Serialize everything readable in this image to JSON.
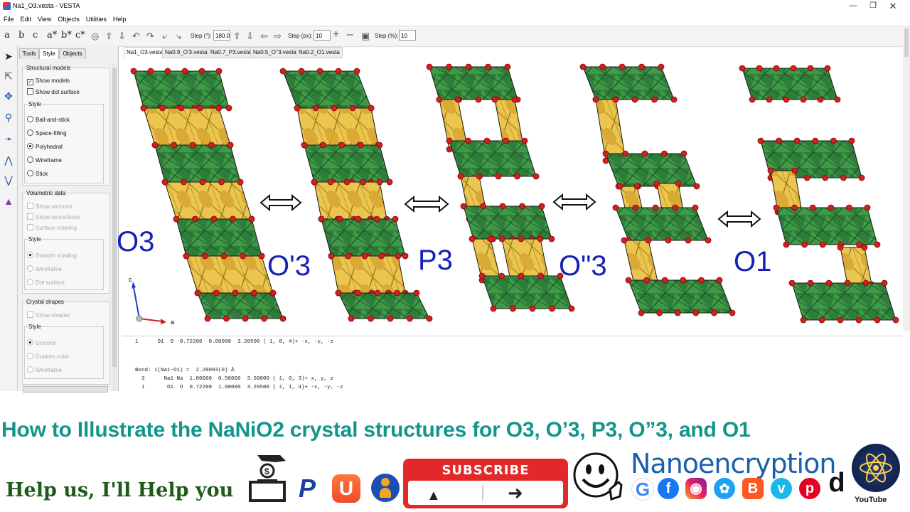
{
  "window": {
    "title": "Na1_O3.vesta - VESTA"
  },
  "menu": [
    "File",
    "Edit",
    "View",
    "Objects",
    "Utilities",
    "Help"
  ],
  "toolbar": {
    "axis_buttons": [
      "a",
      "b",
      "c",
      "a*",
      "b*",
      "c*"
    ],
    "step_deg_label": "Step (°):",
    "step_deg_value": "180.0",
    "step_px_label": "Step (px):",
    "step_px_value": "10",
    "step_pct_label": "Step (%):",
    "step_pct_value": "10"
  },
  "panel": {
    "tabs": [
      "Tools",
      "Style",
      "Objects"
    ],
    "structural": {
      "title": "Structural models",
      "show_models": "Show models",
      "show_dot_surface": "Show dot surface",
      "style_title": "Style",
      "styles": [
        "Ball-and-stick",
        "Space-filling",
        "Polyhedral",
        "Wireframe",
        "Stick"
      ],
      "selected_style": "Polyhedral"
    },
    "volumetric": {
      "title": "Volumetric data",
      "options": [
        "Show sections",
        "Show isosurfaces",
        "Surface coloring"
      ],
      "style_title": "Style",
      "styles": [
        "Smooth shading",
        "Wireframe",
        "Dot surface"
      ]
    },
    "crystal": {
      "title": "Crystal shapes",
      "show_shapes": "Show shapes",
      "style_title": "Style",
      "styles": [
        "Unicolor",
        "Custom color",
        "Wireframe"
      ]
    }
  },
  "doc_tabs": [
    "Na1_O3.vesta",
    "Na0.9_O'3.vesta",
    "Na0.7_P3.vesta",
    "Na0.5_O''3.vesta",
    "Na0.2_O1.vesta"
  ],
  "structures": {
    "labels": [
      "O3",
      "O'3",
      "P3",
      "O\"3",
      "O1"
    ],
    "axis_c": "c",
    "axis_a": "a"
  },
  "text_output": [
    "1      O1  O  0.72200  0.00000  3.20500 ( 1, 0, 4)+ -x, -y, -z",
    "",
    "Bond: 1(Na1-O1) =  2.29093(0) Å",
    "  3      Na1 Na  1.00000  0.50000  3.50000 ( 1, 0, 3)+ x, y, z",
    "  1       O1  O  0.72200  1.00000  3.20500 ( 1, 1, 4)+ -x, -y, -z"
  ],
  "banner": {
    "headline": "How to Illustrate the NaNiO2 crystal structures for O3, O’3, P3, O”3, and O1",
    "help": "Help us, I'll Help you",
    "subscribe": "SUBSCRIBE",
    "brand": "Nanoencryption",
    "youtube": "YouTube"
  },
  "colors": {
    "octa_green": "#2f7d3a",
    "prism_yellow": "#e8c24a",
    "atom_red": "#d61e1e",
    "label_blue": "#1621b6",
    "headline_teal": "#13958c"
  }
}
